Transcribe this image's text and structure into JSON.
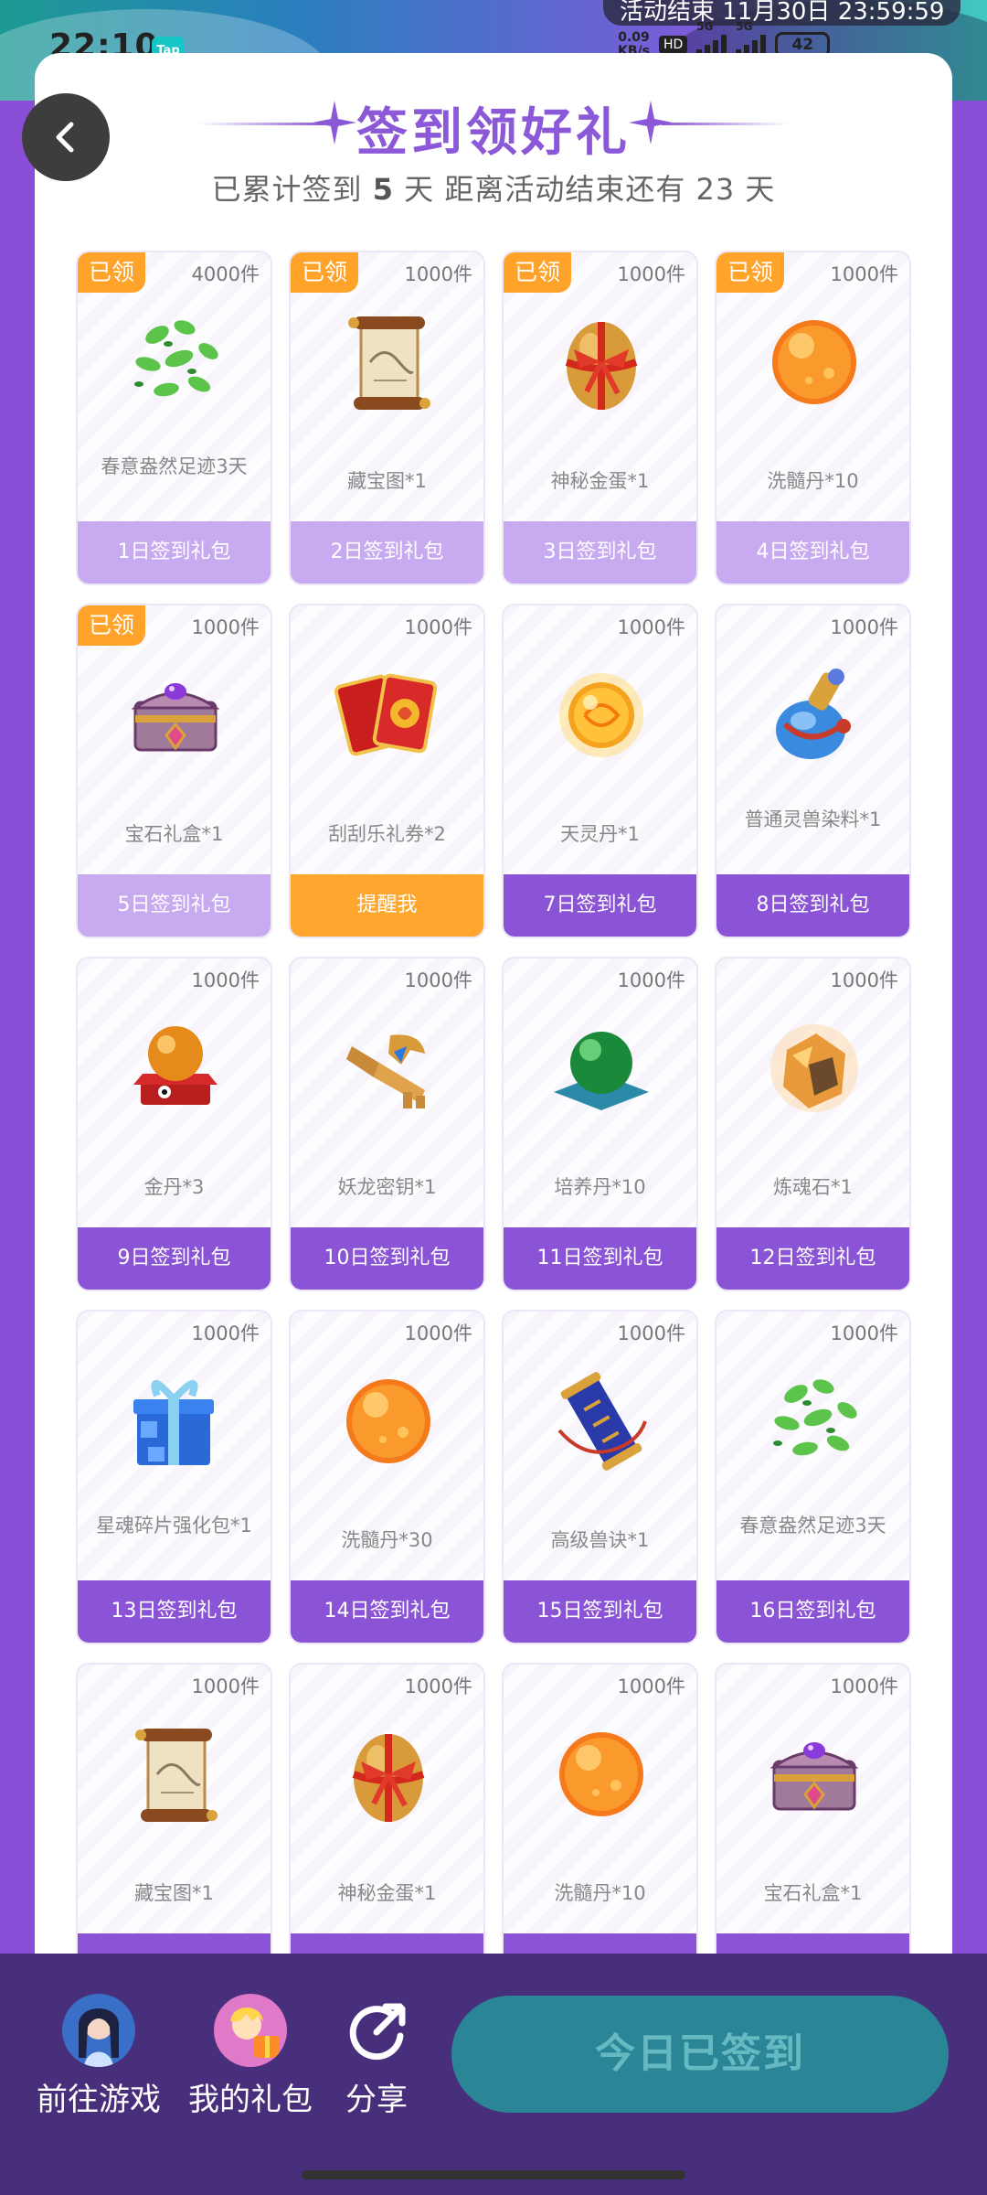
{
  "status_bar": {
    "time": "22:10",
    "app_badge": "Tap",
    "net_speed_value": "0.09",
    "net_speed_unit": "KB/s",
    "hd": "HD",
    "signal1": "5G",
    "signal2": "5G",
    "battery": "42"
  },
  "banner": {
    "end_time": "活动结束 11月30日 23:59:59"
  },
  "header": {
    "title": "签到领好礼",
    "subtitle_prefix": "已累计签到",
    "signed_days": "5",
    "subtitle_mid": "天  距离活动结束还有",
    "remaining_days": "23",
    "subtitle_suffix": "天"
  },
  "rewards": [
    {
      "tag": "已领",
      "count": "4000件",
      "name": "春意盎然足迹3天",
      "button": "1日签到礼包",
      "state": "claimed",
      "icon": "leaves-icon"
    },
    {
      "tag": "已领",
      "count": "1000件",
      "name": "藏宝图*1",
      "button": "2日签到礼包",
      "state": "claimed",
      "icon": "scroll-icon"
    },
    {
      "tag": "已领",
      "count": "1000件",
      "name": "神秘金蛋*1",
      "button": "3日签到礼包",
      "state": "claimed",
      "icon": "golden-egg-icon"
    },
    {
      "tag": "已领",
      "count": "1000件",
      "name": "洗髓丹*10",
      "button": "4日签到礼包",
      "state": "claimed",
      "icon": "orange-orb-icon"
    },
    {
      "tag": "已领",
      "count": "1000件",
      "name": "宝石礼盒*1",
      "button": "5日签到礼包",
      "state": "claimed",
      "icon": "gem-chest-icon"
    },
    {
      "tag": "",
      "count": "1000件",
      "name": "刮刮乐礼券*2",
      "button": "提醒我",
      "state": "remind",
      "icon": "cards-icon"
    },
    {
      "tag": "",
      "count": "1000件",
      "name": "天灵丹*1",
      "button": "7日签到礼包",
      "state": "future",
      "icon": "golden-pill-icon"
    },
    {
      "tag": "",
      "count": "1000件",
      "name": "普通灵兽染料*1",
      "button": "8日签到礼包",
      "state": "future",
      "icon": "potion-icon"
    },
    {
      "tag": "",
      "count": "1000件",
      "name": "金丹*3",
      "button": "9日签到礼包",
      "state": "future",
      "icon": "gold-orb-stand-icon"
    },
    {
      "tag": "",
      "count": "1000件",
      "name": "妖龙密钥*1",
      "button": "10日签到礼包",
      "state": "future",
      "icon": "key-icon"
    },
    {
      "tag": "",
      "count": "1000件",
      "name": "培养丹*10",
      "button": "11日签到礼包",
      "state": "future",
      "icon": "green-orb-icon"
    },
    {
      "tag": "",
      "count": "1000件",
      "name": "炼魂石*1",
      "button": "12日签到礼包",
      "state": "future",
      "icon": "ore-icon"
    },
    {
      "tag": "",
      "count": "1000件",
      "name": "星魂碎片强化包*1",
      "button": "13日签到礼包",
      "state": "future",
      "icon": "blue-gift-icon"
    },
    {
      "tag": "",
      "count": "1000件",
      "name": "洗髓丹*30",
      "button": "14日签到礼包",
      "state": "future",
      "icon": "orange-orb-icon"
    },
    {
      "tag": "",
      "count": "1000件",
      "name": "高级兽诀*1",
      "button": "15日签到礼包",
      "state": "future",
      "icon": "beast-scroll-icon"
    },
    {
      "tag": "",
      "count": "1000件",
      "name": "春意盎然足迹3天",
      "button": "16日签到礼包",
      "state": "future",
      "icon": "leaves-icon"
    },
    {
      "tag": "",
      "count": "1000件",
      "name": "藏宝图*1",
      "button": "",
      "state": "future",
      "icon": "scroll-icon"
    },
    {
      "tag": "",
      "count": "1000件",
      "name": "神秘金蛋*1",
      "button": "",
      "state": "future",
      "icon": "golden-egg-icon"
    },
    {
      "tag": "",
      "count": "1000件",
      "name": "洗髓丹*10",
      "button": "",
      "state": "future",
      "icon": "orange-orb-icon"
    },
    {
      "tag": "",
      "count": "1000件",
      "name": "宝石礼盒*1",
      "button": "",
      "state": "future",
      "icon": "gem-chest-icon"
    }
  ],
  "bottom_bar": {
    "go_game": "前往游戏",
    "my_gifts": "我的礼包",
    "share": "分享",
    "signed_today": "今日已签到"
  },
  "colors": {
    "accent": "#8b58d8",
    "claimed": "#c7aaf0",
    "remind": "#ffa62e",
    "future": "#8b54d6",
    "bottom_bar": "#472f7c",
    "signed_button": "#2a8696"
  }
}
